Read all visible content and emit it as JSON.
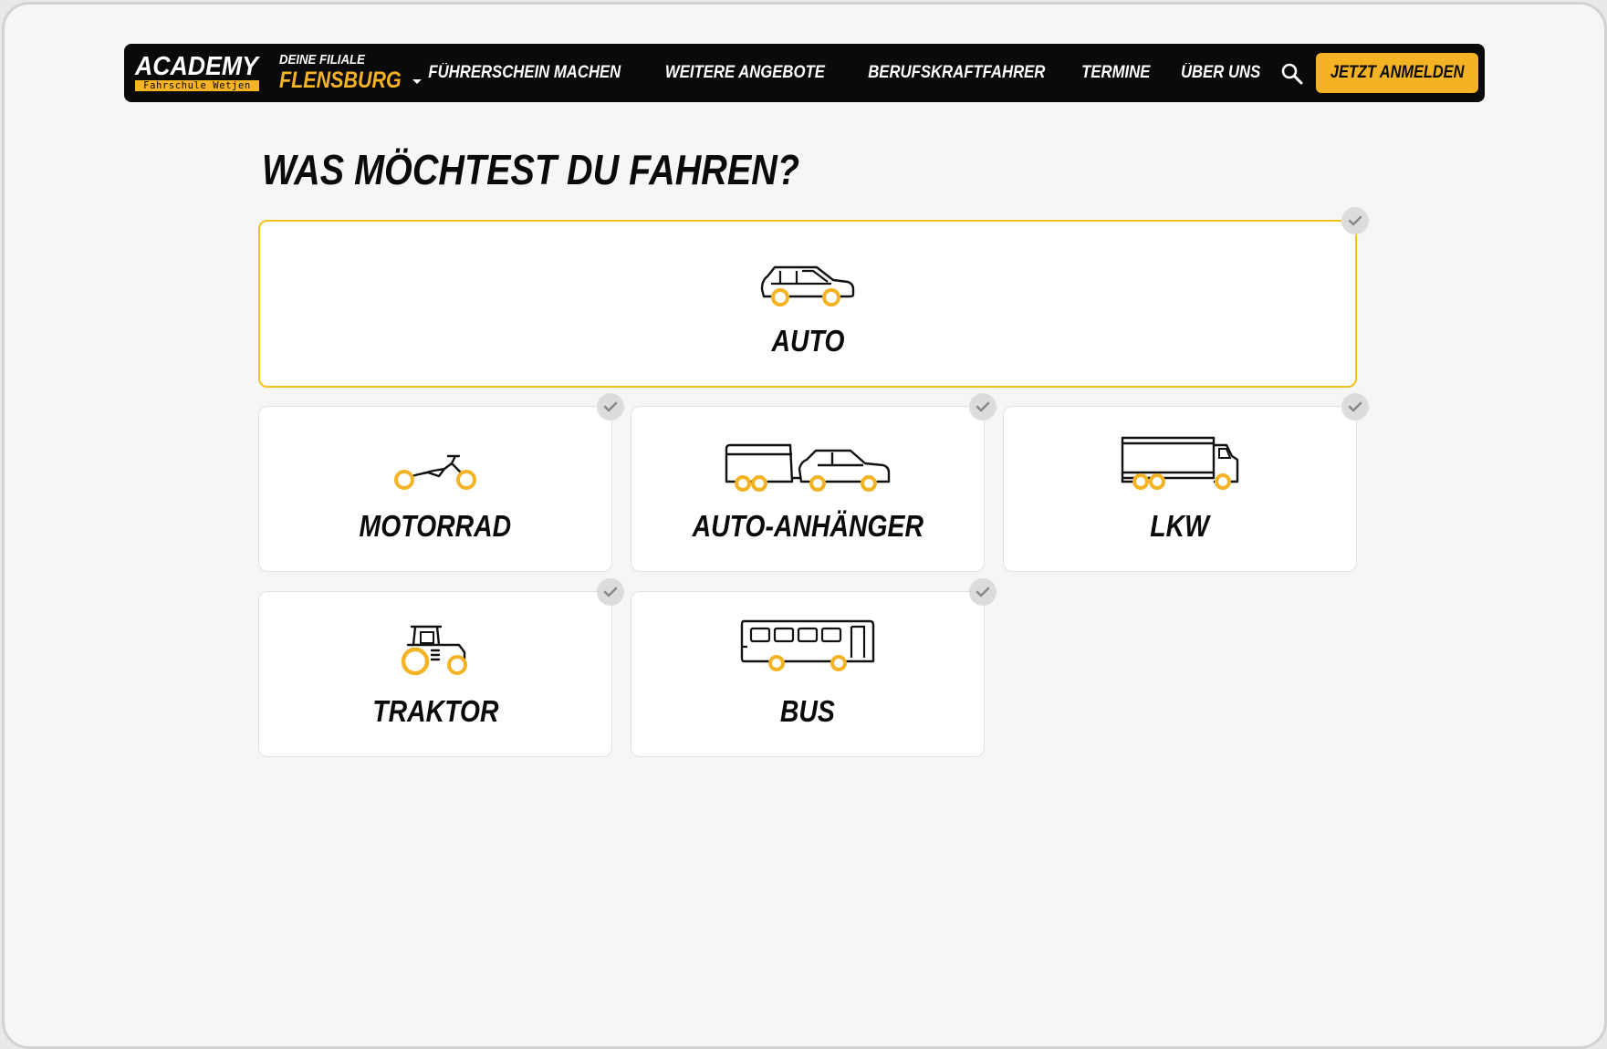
{
  "brand": {
    "logo_word": "ACADEMY",
    "logo_sub": "Fahrschule Wetjen",
    "branch_label": "DEINE FILIALE",
    "branch_city": "FLENSBURG",
    "accent": "#f4b324",
    "dark": "#0a0a0a"
  },
  "nav": {
    "items": [
      {
        "label": "FÜHRERSCHEIN MACHEN"
      },
      {
        "label": "WEITERE ANGEBOTE"
      },
      {
        "label": "BERUFSKRAFTFAHRER"
      },
      {
        "label": "TERMINE"
      },
      {
        "label": "ÜBER UNS"
      }
    ],
    "search_icon": "search-icon",
    "cta_label": "JETZT ANMELDEN"
  },
  "main": {
    "heading": "WAS MÖCHTEST DU FAHREN?",
    "options": [
      {
        "label": "AUTO",
        "icon": "car-icon",
        "selected": true
      },
      {
        "label": "MOTORRAD",
        "icon": "motorcycle-icon",
        "selected": false
      },
      {
        "label": "AUTO-ANHÄNGER",
        "icon": "car-trailer-icon",
        "selected": false
      },
      {
        "label": "LKW",
        "icon": "truck-icon",
        "selected": false
      },
      {
        "label": "TRAKTOR",
        "icon": "tractor-icon",
        "selected": false
      },
      {
        "label": "BUS",
        "icon": "bus-icon",
        "selected": false
      }
    ]
  }
}
